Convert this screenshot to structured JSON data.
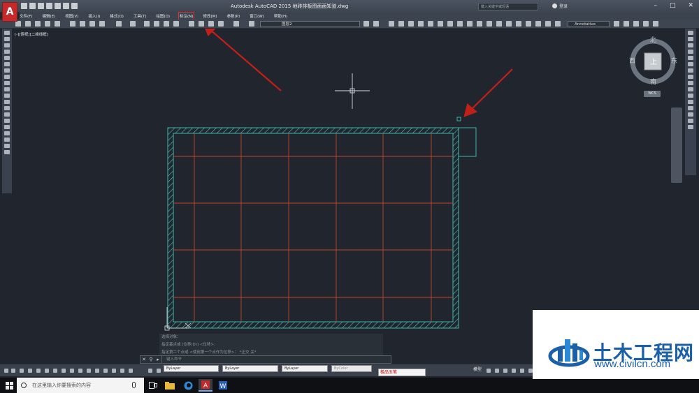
{
  "title_bar": {
    "app_title": "Autodesk AutoCAD 2015      地砖排板图面面知道.dwg",
    "search_placeholder": "键入关键字或短语",
    "login_label": "登录"
  },
  "menu": {
    "items": [
      {
        "label": "文件(F)"
      },
      {
        "label": "编辑(E)"
      },
      {
        "label": "视图(V)"
      },
      {
        "label": "插入(I)"
      },
      {
        "label": "格式(O)"
      },
      {
        "label": "工具(T)"
      },
      {
        "label": "绘图(D)"
      },
      {
        "label": "标注(N)"
      },
      {
        "label": "修改(M)"
      },
      {
        "label": "参数(P)"
      },
      {
        "label": "窗口(W)"
      },
      {
        "label": "帮助(H)"
      }
    ]
  },
  "toolbar": {
    "layer_value": "图层2",
    "annotation_scale": "Annotative"
  },
  "viewport": {
    "label": "[-][俯视][二维线框]"
  },
  "viewcube": {
    "north": "北",
    "south": "南",
    "east": "东",
    "west": "西",
    "top_face": "上",
    "wcs": "WCS"
  },
  "command": {
    "history": [
      "选择对象：",
      "指定基点或 [位移(D)] <位移>：",
      "指定第二个点或 <使用第一个点作为位移>：  *正交 关*"
    ],
    "prompt_placeholder": "键入命令"
  },
  "properties": {
    "color": "ByLayer",
    "linetype": "ByLayer",
    "lineweight": "ByLayer",
    "plot_style": "ByColor"
  },
  "status": {
    "model_tab": "模型",
    "ime_label": "极品五笔"
  },
  "taskbar": {
    "search_placeholder": "在这里输入你要搜索的内容"
  },
  "watermark": {
    "title": "土木工程网",
    "url": "www.civilcn.com"
  },
  "colors": {
    "background": "#21252d",
    "grid_lines": "#c0482a",
    "hatch": "#3fb8b0",
    "annotation_arrow": "#c0201a",
    "brand_blue": "#1b5fa8"
  }
}
